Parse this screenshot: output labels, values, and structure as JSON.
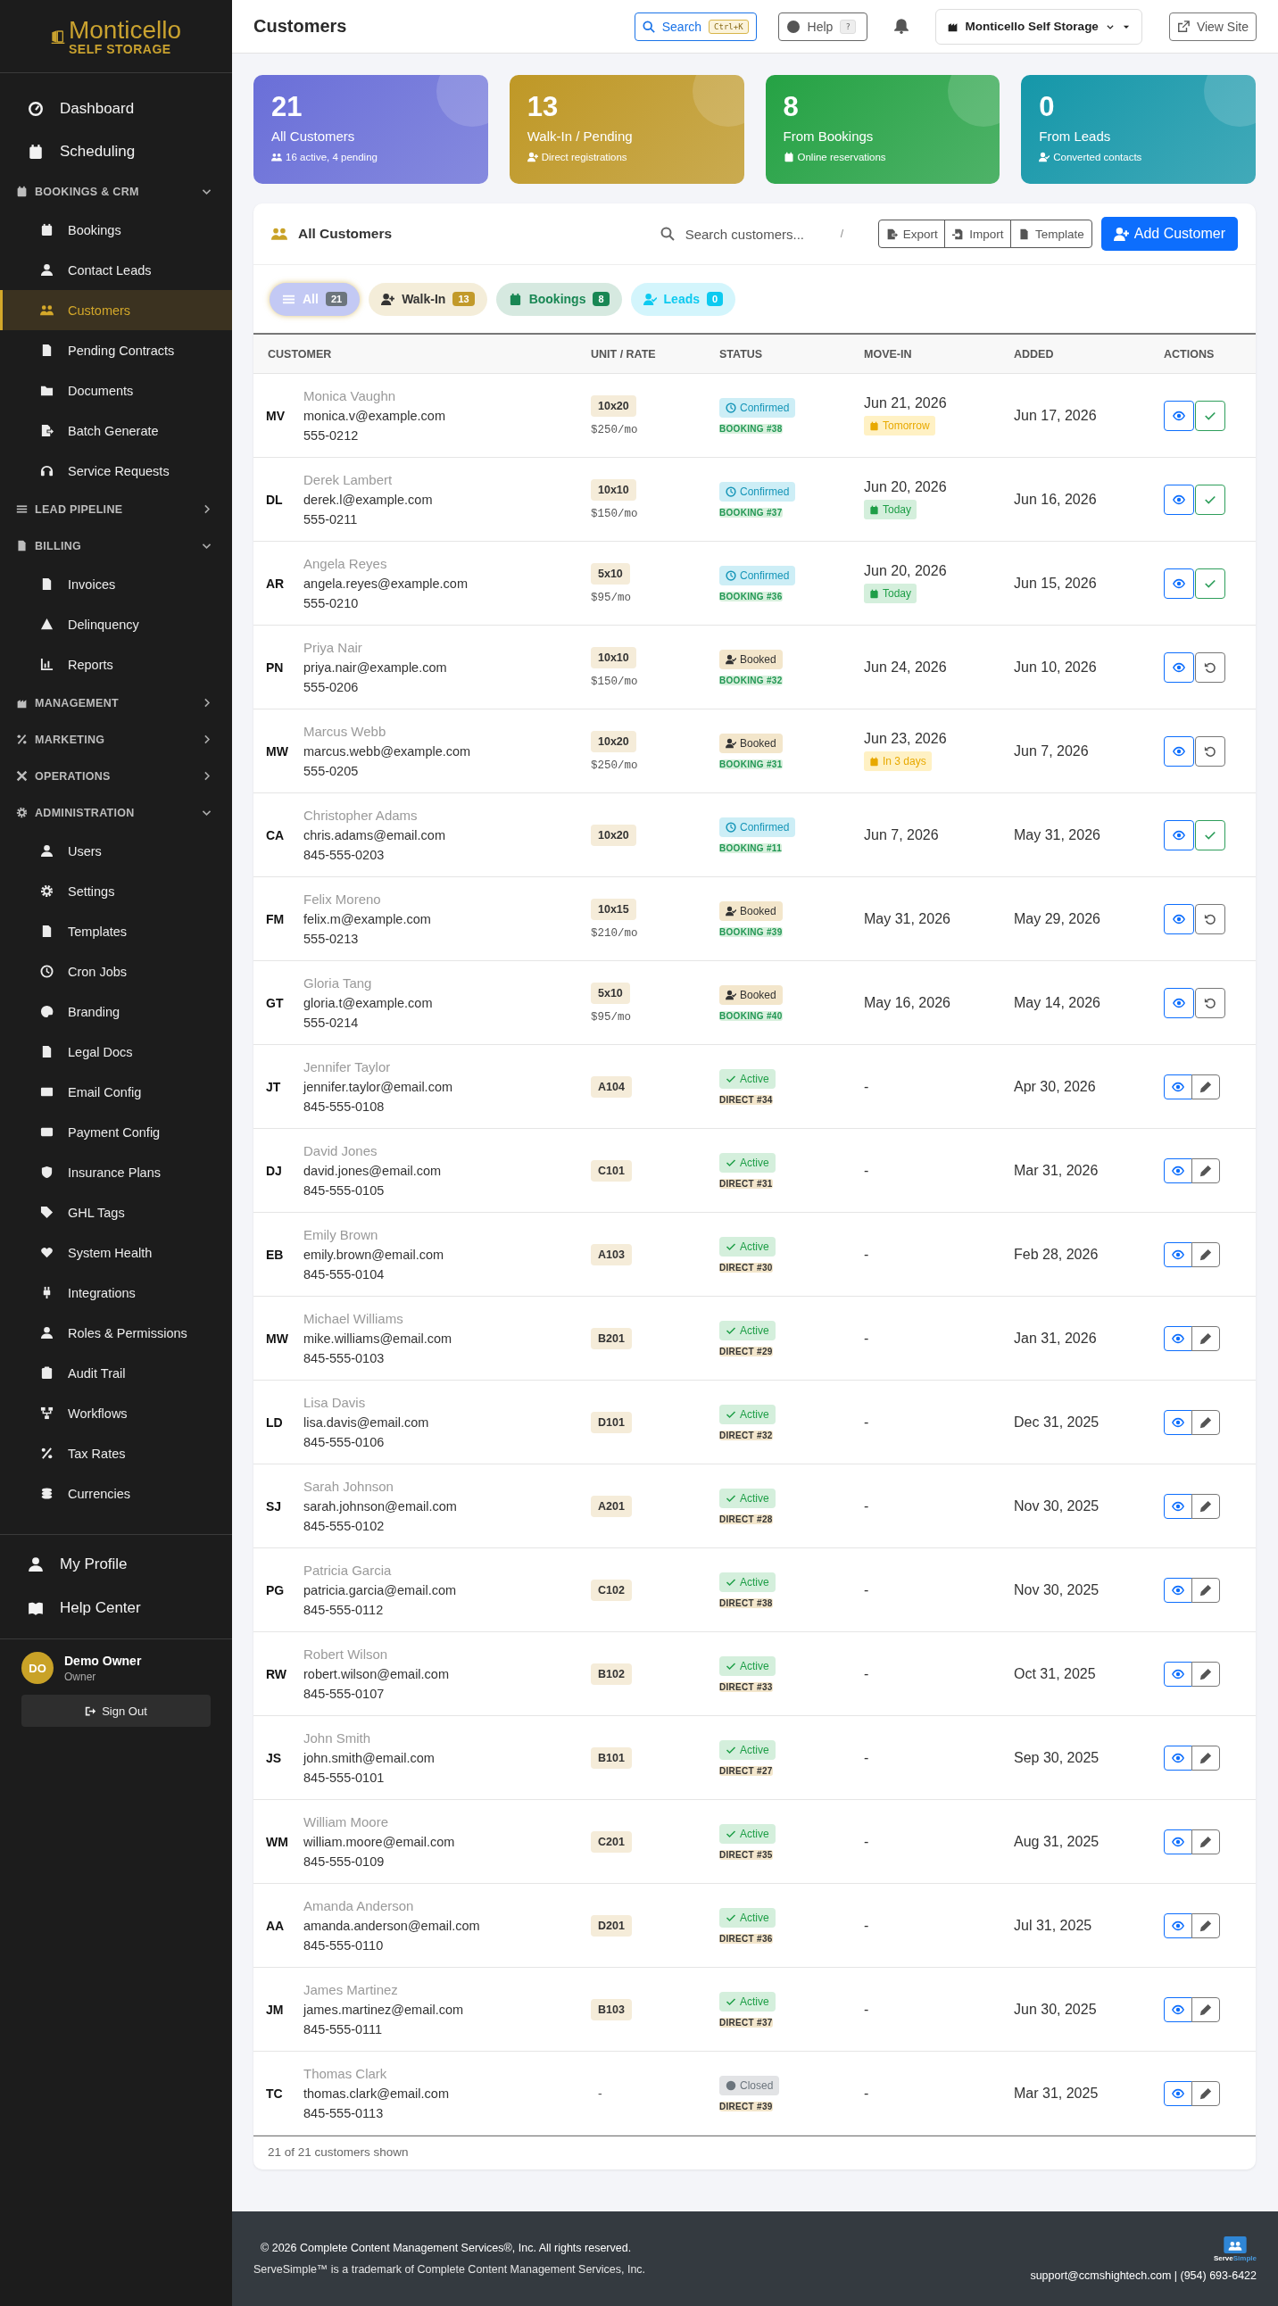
{
  "sidebar": {
    "logo": {
      "name": "Monticello",
      "tagline": "SELF STORAGE"
    },
    "nav": [
      {
        "kind": "link",
        "label": "Dashboard",
        "selected": false
      },
      {
        "kind": "link",
        "label": "Scheduling",
        "selected": false
      },
      {
        "kind": "section",
        "label": "BOOKINGS & CRM",
        "expanded": true,
        "children": [
          {
            "label": "Bookings",
            "selected": false
          },
          {
            "label": "Contact Leads",
            "selected": false
          },
          {
            "label": "Customers",
            "selected": true
          },
          {
            "label": "Pending Contracts",
            "selected": false
          },
          {
            "label": "Documents",
            "selected": false
          },
          {
            "label": "Batch Generate",
            "selected": false
          },
          {
            "label": "Service Requests",
            "selected": false
          }
        ]
      },
      {
        "kind": "section",
        "label": "LEAD PIPELINE",
        "expanded": false
      },
      {
        "kind": "section",
        "label": "BILLING",
        "expanded": true,
        "children": [
          {
            "label": "Invoices",
            "selected": false
          },
          {
            "label": "Delinquency",
            "selected": false
          },
          {
            "label": "Reports",
            "selected": false
          }
        ]
      },
      {
        "kind": "section",
        "label": "MANAGEMENT",
        "expanded": false
      },
      {
        "kind": "section",
        "label": "MARKETING",
        "expanded": false
      },
      {
        "kind": "section",
        "label": "OPERATIONS",
        "expanded": false
      },
      {
        "kind": "section",
        "label": "ADMINISTRATION",
        "expanded": true,
        "children": [
          {
            "label": "Users",
            "selected": false
          },
          {
            "label": "Settings",
            "selected": false
          },
          {
            "label": "Templates",
            "selected": false
          },
          {
            "label": "Cron Jobs",
            "selected": false
          },
          {
            "label": "Branding",
            "selected": false
          },
          {
            "label": "Legal Docs",
            "selected": false
          },
          {
            "label": "Email Config",
            "selected": false
          },
          {
            "label": "Payment Config",
            "selected": false
          },
          {
            "label": "Insurance Plans",
            "selected": false
          },
          {
            "label": "GHL Tags",
            "selected": false
          },
          {
            "label": "System Health",
            "selected": false
          },
          {
            "label": "Integrations",
            "selected": false
          },
          {
            "label": "Roles & Permissions",
            "selected": false
          },
          {
            "label": "Audit Trail",
            "selected": false
          },
          {
            "label": "Workflows",
            "selected": false
          },
          {
            "label": "Tax Rates",
            "selected": false
          },
          {
            "label": "Currencies",
            "selected": false
          }
        ]
      }
    ],
    "footer_nav": [
      {
        "label": "My Profile",
        "selected": false
      },
      {
        "label": "Help Center",
        "selected": false
      }
    ],
    "user": {
      "initials": "DO",
      "name": "Demo Owner",
      "role": "Owner"
    },
    "sign_out": "Sign Out"
  },
  "header": {
    "title": "Customers",
    "search": {
      "label": "Search",
      "shortcut": "Ctrl+K"
    },
    "help": {
      "label": "Help",
      "shortcut": "?"
    },
    "location": "Monticello Self Storage",
    "view_site": "View Site"
  },
  "stats": [
    {
      "value": "21",
      "label": "All Customers",
      "note": "16 active, 4 pending",
      "color": "#6a6fd8"
    },
    {
      "value": "13",
      "label": "Walk-In / Pending",
      "note": "Direct registrations",
      "color": "#bf9826"
    },
    {
      "value": "8",
      "label": "From Bookings",
      "note": "Online reservations",
      "color": "#25a244"
    },
    {
      "value": "0",
      "label": "From Leads",
      "note": "Converted contacts",
      "color": "#1597a9"
    }
  ],
  "table_card": {
    "title": "All Customers",
    "search": {
      "placeholder": "Search customers...",
      "shortcut": "/"
    },
    "tools": [
      "Export",
      "Import",
      "Template"
    ],
    "add_button": "Add Customer",
    "filters": [
      {
        "label": "All",
        "count": "21",
        "selected": true,
        "color": "#6c757d"
      },
      {
        "label": "Walk-In",
        "count": "13",
        "selected": false,
        "color": "#c29a2a"
      },
      {
        "label": "Bookings",
        "count": "8",
        "selected": false,
        "color": "#198754"
      },
      {
        "label": "Leads",
        "count": "0",
        "selected": false,
        "color": "#0dcaf0"
      }
    ],
    "columns": [
      "CUSTOMER",
      "UNIT / RATE",
      "STATUS",
      "MOVE-IN",
      "ADDED",
      "ACTIONS"
    ],
    "rows": [
      {
        "initials": "MV",
        "name": "Monica Vaughn",
        "email": "monica.v@example.com",
        "phone": "555-0212",
        "unit": {
          "kind": "badge",
          "label": "10x20"
        },
        "rate": "$250/mo",
        "status": {
          "kind": "confirmed",
          "label": "Confirmed"
        },
        "ref": {
          "kind": "booking",
          "label": "BOOKING #38"
        },
        "move_in": "Jun 21, 2026",
        "move_in_badge": {
          "kind": "soon",
          "label": "Tomorrow"
        },
        "added": "Jun 17, 2026",
        "action": {
          "kind": "confirm"
        }
      },
      {
        "initials": "DL",
        "name": "Derek Lambert",
        "email": "derek.l@example.com",
        "phone": "555-0211",
        "unit": {
          "kind": "badge",
          "label": "10x10"
        },
        "rate": "$150/mo",
        "status": {
          "kind": "confirmed",
          "label": "Confirmed"
        },
        "ref": {
          "kind": "booking",
          "label": "BOOKING #37"
        },
        "move_in": "Jun 20, 2026",
        "move_in_badge": {
          "kind": "today",
          "label": "Today"
        },
        "added": "Jun 16, 2026",
        "action": {
          "kind": "confirm"
        }
      },
      {
        "initials": "AR",
        "name": "Angela Reyes",
        "email": "angela.reyes@example.com",
        "phone": "555-0210",
        "unit": {
          "kind": "badge",
          "label": "5x10"
        },
        "rate": "$95/mo",
        "status": {
          "kind": "confirmed",
          "label": "Confirmed"
        },
        "ref": {
          "kind": "booking",
          "label": "BOOKING #36"
        },
        "move_in": "Jun 20, 2026",
        "move_in_badge": {
          "kind": "today",
          "label": "Today"
        },
        "added": "Jun 15, 2026",
        "action": {
          "kind": "confirm"
        }
      },
      {
        "initials": "PN",
        "name": "Priya Nair",
        "email": "priya.nair@example.com",
        "phone": "555-0206",
        "unit": {
          "kind": "badge",
          "label": "10x10"
        },
        "rate": "$150/mo",
        "status": {
          "kind": "booked",
          "label": "Booked"
        },
        "ref": {
          "kind": "booking",
          "label": "BOOKING #32"
        },
        "move_in": "Jun 24, 2026",
        "added": "Jun 10, 2026",
        "action": {
          "kind": "revert"
        }
      },
      {
        "initials": "MW",
        "name": "Marcus Webb",
        "email": "marcus.webb@example.com",
        "phone": "555-0205",
        "unit": {
          "kind": "badge",
          "label": "10x20"
        },
        "rate": "$250/mo",
        "status": {
          "kind": "booked",
          "label": "Booked"
        },
        "ref": {
          "kind": "booking",
          "label": "BOOKING #31"
        },
        "move_in": "Jun 23, 2026",
        "move_in_badge": {
          "kind": "soon",
          "label": "In 3 days"
        },
        "added": "Jun 7, 2026",
        "action": {
          "kind": "revert"
        }
      },
      {
        "initials": "CA",
        "name": "Christopher Adams",
        "email": "chris.adams@email.com",
        "phone": "845-555-0203",
        "unit": {
          "kind": "badge",
          "label": "10x20"
        },
        "status": {
          "kind": "confirmed",
          "label": "Confirmed"
        },
        "ref": {
          "kind": "booking",
          "label": "BOOKING #11"
        },
        "move_in": "Jun 7, 2026",
        "added": "May 31, 2026",
        "action": {
          "kind": "confirm"
        }
      },
      {
        "initials": "FM",
        "name": "Felix Moreno",
        "email": "felix.m@example.com",
        "phone": "555-0213",
        "unit": {
          "kind": "badge",
          "label": "10x15"
        },
        "rate": "$210/mo",
        "status": {
          "kind": "booked",
          "label": "Booked"
        },
        "ref": {
          "kind": "booking",
          "label": "BOOKING #39"
        },
        "move_in": "May 31, 2026",
        "added": "May 29, 2026",
        "action": {
          "kind": "revert"
        }
      },
      {
        "initials": "GT",
        "name": "Gloria Tang",
        "email": "gloria.t@example.com",
        "phone": "555-0214",
        "unit": {
          "kind": "badge",
          "label": "5x10"
        },
        "rate": "$95/mo",
        "status": {
          "kind": "booked",
          "label": "Booked"
        },
        "ref": {
          "kind": "booking",
          "label": "BOOKING #40"
        },
        "move_in": "May 16, 2026",
        "added": "May 14, 2026",
        "action": {
          "kind": "revert"
        }
      },
      {
        "initials": "JT",
        "name": "Jennifer Taylor",
        "email": "jennifer.taylor@email.com",
        "phone": "845-555-0108",
        "unit": {
          "kind": "badge",
          "label": "A104"
        },
        "status": {
          "kind": "active",
          "label": "Active"
        },
        "ref": {
          "kind": "direct",
          "label": "DIRECT #34"
        },
        "move_in": "-",
        "added": "Apr 30, 2026",
        "action": {
          "kind": "edit"
        }
      },
      {
        "initials": "DJ",
        "name": "David Jones",
        "email": "david.jones@email.com",
        "phone": "845-555-0105",
        "unit": {
          "kind": "badge",
          "label": "C101"
        },
        "status": {
          "kind": "active",
          "label": "Active"
        },
        "ref": {
          "kind": "direct",
          "label": "DIRECT #31"
        },
        "move_in": "-",
        "added": "Mar 31, 2026",
        "action": {
          "kind": "edit"
        }
      },
      {
        "initials": "EB",
        "name": "Emily Brown",
        "email": "emily.brown@email.com",
        "phone": "845-555-0104",
        "unit": {
          "kind": "badge",
          "label": "A103"
        },
        "status": {
          "kind": "active",
          "label": "Active"
        },
        "ref": {
          "kind": "direct",
          "label": "DIRECT #30"
        },
        "move_in": "-",
        "added": "Feb 28, 2026",
        "action": {
          "kind": "edit"
        }
      },
      {
        "initials": "MW",
        "name": "Michael Williams",
        "email": "mike.williams@email.com",
        "phone": "845-555-0103",
        "unit": {
          "kind": "badge",
          "label": "B201"
        },
        "status": {
          "kind": "active",
          "label": "Active"
        },
        "ref": {
          "kind": "direct",
          "label": "DIRECT #29"
        },
        "move_in": "-",
        "added": "Jan 31, 2026",
        "action": {
          "kind": "edit"
        }
      },
      {
        "initials": "LD",
        "name": "Lisa Davis",
        "email": "lisa.davis@email.com",
        "phone": "845-555-0106",
        "unit": {
          "kind": "badge",
          "label": "D101"
        },
        "status": {
          "kind": "active",
          "label": "Active"
        },
        "ref": {
          "kind": "direct",
          "label": "DIRECT #32"
        },
        "move_in": "-",
        "added": "Dec 31, 2025",
        "action": {
          "kind": "edit"
        }
      },
      {
        "initials": "SJ",
        "name": "Sarah Johnson",
        "email": "sarah.johnson@email.com",
        "phone": "845-555-0102",
        "unit": {
          "kind": "badge",
          "label": "A201"
        },
        "status": {
          "kind": "active",
          "label": "Active"
        },
        "ref": {
          "kind": "direct",
          "label": "DIRECT #28"
        },
        "move_in": "-",
        "added": "Nov 30, 2025",
        "action": {
          "kind": "edit"
        }
      },
      {
        "initials": "PG",
        "name": "Patricia Garcia",
        "email": "patricia.garcia@email.com",
        "phone": "845-555-0112",
        "unit": {
          "kind": "badge",
          "label": "C102"
        },
        "status": {
          "kind": "active",
          "label": "Active"
        },
        "ref": {
          "kind": "direct",
          "label": "DIRECT #38"
        },
        "move_in": "-",
        "added": "Nov 30, 2025",
        "action": {
          "kind": "edit"
        }
      },
      {
        "initials": "RW",
        "name": "Robert Wilson",
        "email": "robert.wilson@email.com",
        "phone": "845-555-0107",
        "unit": {
          "kind": "badge",
          "label": "B102"
        },
        "status": {
          "kind": "active",
          "label": "Active"
        },
        "ref": {
          "kind": "direct",
          "label": "DIRECT #33"
        },
        "move_in": "-",
        "added": "Oct 31, 2025",
        "action": {
          "kind": "edit"
        }
      },
      {
        "initials": "JS",
        "name": "John Smith",
        "email": "john.smith@email.com",
        "phone": "845-555-0101",
        "unit": {
          "kind": "badge",
          "label": "B101"
        },
        "status": {
          "kind": "active",
          "label": "Active"
        },
        "ref": {
          "kind": "direct",
          "label": "DIRECT #27"
        },
        "move_in": "-",
        "added": "Sep 30, 2025",
        "action": {
          "kind": "edit"
        }
      },
      {
        "initials": "WM",
        "name": "William Moore",
        "email": "william.moore@email.com",
        "phone": "845-555-0109",
        "unit": {
          "kind": "badge",
          "label": "C201"
        },
        "status": {
          "kind": "active",
          "label": "Active"
        },
        "ref": {
          "kind": "direct",
          "label": "DIRECT #35"
        },
        "move_in": "-",
        "added": "Aug 31, 2025",
        "action": {
          "kind": "edit"
        }
      },
      {
        "initials": "AA",
        "name": "Amanda Anderson",
        "email": "amanda.anderson@email.com",
        "phone": "845-555-0110",
        "unit": {
          "kind": "badge",
          "label": "D201"
        },
        "status": {
          "kind": "active",
          "label": "Active"
        },
        "ref": {
          "kind": "direct",
          "label": "DIRECT #36"
        },
        "move_in": "-",
        "added": "Jul 31, 2025",
        "action": {
          "kind": "edit"
        }
      },
      {
        "initials": "JM",
        "name": "James Martinez",
        "email": "james.martinez@email.com",
        "phone": "845-555-0111",
        "unit": {
          "kind": "badge",
          "label": "B103"
        },
        "status": {
          "kind": "active",
          "label": "Active"
        },
        "ref": {
          "kind": "direct",
          "label": "DIRECT #37"
        },
        "move_in": "-",
        "added": "Jun 30, 2025",
        "action": {
          "kind": "edit"
        }
      },
      {
        "initials": "TC",
        "name": "Thomas Clark",
        "email": "thomas.clark@email.com",
        "phone": "845-555-0113",
        "unit": {
          "kind": "plain",
          "label": "-"
        },
        "status": {
          "kind": "closed",
          "label": "Closed"
        },
        "ref": {
          "kind": "direct",
          "label": "DIRECT #39"
        },
        "move_in": "-",
        "added": "Mar 31, 2025",
        "action": {
          "kind": "edit"
        }
      }
    ],
    "status_bar": "21 of 21 customers shown"
  },
  "footer": {
    "copyright": "© 2026 Complete Content Management Services®, Inc. All rights reserved.",
    "trademark": "ServeSimple™ is a trademark of Complete Content Management Services, Inc.",
    "brand": {
      "first": "Serve",
      "second": "Simple"
    },
    "contact": "support@ccmshightech.com | (954) 693-6422"
  }
}
